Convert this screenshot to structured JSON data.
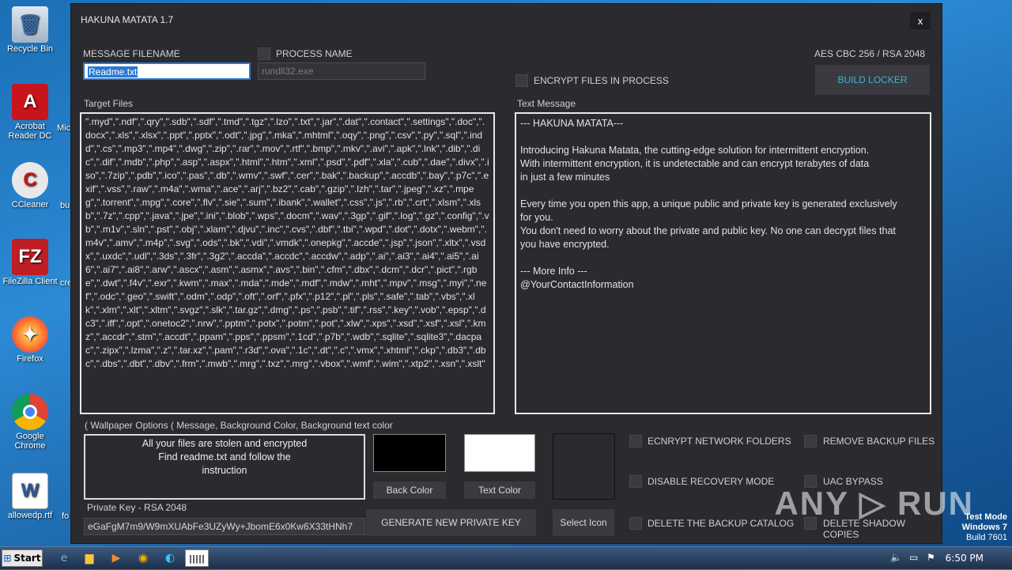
{
  "desktop": {
    "icons": [
      {
        "label": "Recycle Bin"
      },
      {
        "label": "Acrobat Reader DC"
      },
      {
        "label": "CCleaner"
      },
      {
        "label": "FileZilla Client"
      },
      {
        "label": "Firefox"
      },
      {
        "label": "Google Chrome"
      },
      {
        "label": "allowedp.rtf"
      }
    ],
    "edge_labels": [
      "Mic",
      "bu",
      "cre",
      "fo"
    ]
  },
  "window": {
    "title": "HAKUNA MATATA 1.7",
    "close": "x",
    "message_filename_label": "MESSAGE FILENAME",
    "message_filename_value": "Readme.txt",
    "process_name_label": "PROCESS NAME",
    "process_name_value": "rundll32.exe",
    "crypto_label": "AES CBC 256 / RSA 2048",
    "encrypt_in_process_label": "ENCRYPT FILES IN PROCESS",
    "build_button": "BUILD LOCKER",
    "target_files_label": "Target Files",
    "target_files_text": "\".myd\",\".ndf\",\".qry\",\".sdb\",\".sdf\",\".tmd\",\".tgz\",\".lzo\",\".txt\",\".jar\",\".dat\",\".contact\",\".settings\",\".doc\",\".docx\",\".xls\",\".xlsx\",\".ppt\",\".pptx\",\".odt\",\".jpg\",\".mka\",\".mhtml\",\".oqy\",\".png\",\".csv\",\".py\",\".sql\",\".indd\",\".cs\",\".mp3\",\".mp4\",\".dwg\",\".zip\",\".rar\",\".mov\",\".rtf\",\".bmp\",\".mkv\",\".avi\",\".apk\",\".lnk\",\".dib\",\".dic\",\".dif\",\".mdb\",\".php\",\".asp\",\".aspx\",\".html\",\".htm\",\".xml\",\".psd\",\".pdf\",\".xla\",\".cub\",\".dae\",\".divx\",\".iso\",\".7zip\",\".pdb\",\".ico\",\".pas\",\".db\",\".wmv\",\".swf\",\".cer\",\".bak\",\".backup\",\".accdb\",\".bay\",\".p7c\",\".exif\",\".vss\",\".raw\",\".m4a\",\".wma\",\".ace\",\".arj\",\".bz2\",\".cab\",\".gzip\",\".lzh\",\".tar\",\".jpeg\",\".xz\",\".mpeg\",\".torrent\",\".mpg\",\".core\",\".flv\",\".sie\",\".sum\",\".ibank\",\".wallet\",\".css\",\".js\",\".rb\",\".crt\",\".xlsm\",\".xlsb\",\".7z\",\".cpp\",\".java\",\".jpe\",\".ini\",\".blob\",\".wps\",\".docm\",\".wav\",\".3gp\",\".gif\",\".log\",\".gz\",\".config\",\".vb\",\".m1v\",\".sln\",\".pst\",\".obj\",\".xlam\",\".djvu\",\".inc\",\".cvs\",\".dbf\",\".tbi\",\".wpd\",\".dot\",\".dotx\",\".webm\",\".m4v\",\".amv\",\".m4p\",\".svg\",\".ods\",\".bk\",\".vdi\",\".vmdk\",\".onepkg\",\".accde\",\".jsp\",\".json\",\".xltx\",\".vsdx\",\".uxdc\",\".udl\",\".3ds\",\".3fr\",\".3g2\",\".accda\",\".accdc\",\".accdw\",\".adp\",\".ai\",\".ai3\",\".ai4\",\".ai5\",\".ai6\",\".ai7\",\".ai8\",\".arw\",\".ascx\",\".asm\",\".asmx\",\".avs\",\".bin\",\".cfm\",\".dbx\",\".dcm\",\".dcr\",\".pict\",\".rgbe\",\".dwt\",\".f4v\",\".exr\",\".kwm\",\".max\",\".mda\",\".mde\",\".mdf\",\".mdw\",\".mht\",\".mpv\",\".msg\",\".myi\",\".nef\",\".odc\",\".geo\",\".swift\",\".odm\",\".odp\",\".oft\",\".orf\",\".pfx\",\".p12\",\".pl\",\".pls\",\".safe\",\".tab\",\".vbs\",\".xlk\",\".xlm\",\".xlt\",\".xltm\",\".svgz\",\".slk\",\".tar.gz\",\".dmg\",\".ps\",\".psb\",\".tif\",\".rss\",\".key\",\".vob\",\".epsp\",\".dc3\",\".iff\",\".opt\",\".onetoc2\",\".nrw\",\".pptm\",\".potx\",\".potm\",\".pot\",\".xlw\",\".xps\",\".xsd\",\".xsf\",\".xsl\",\".kmz\",\".accdr\",\".stm\",\".accdt\",\".ppam\",\".pps\",\".ppsm\",\".1cd\",\".p7b\",\".wdb\",\".sqlite\",\".sqlite3\",\".dacpac\",\".zipx\",\".lzma\",\".z\",\".tar.xz\",\".pam\",\".r3d\",\".ova\",\".1c\",\".dt\",\".c\",\".vmx\",\".xhtml\",\".ckp\",\".db3\",\".dbc\",\".dbs\",\".dbt\",\".dbv\",\".frm\",\".mwb\",\".mrg\",\".txz\",\".mrg\",\".vbox\",\".wmf\",\".wim\",\".xtp2\",\".xsn\",\".xslt\"",
    "text_message_label": "Text Message",
    "text_message": "--- HAKUNA MATATA---\n\nIntroducing Hakuna Matata, the cutting-edge solution for intermittent encryption.\nWith intermittent encryption, it is undetectable and can encrypt terabytes of data\nin just a few minutes\n\nEvery time you open this app, a unique public and private key is generated exclusively\nfor you.\nYou don't need to worry about the private and public key. No one can decrypt files that\nyou have encrypted.\n\n--- More Info ---\n@YourContactInformation",
    "wallpaper_label": "( Wallpaper Options ( Message, Background Color, Background text color",
    "wallpaper_message": "All your files are stolen and encrypted\nFind readme.txt and follow the\ninstruction",
    "back_color_button": "Back Color",
    "text_color_button": "Text Color",
    "select_icon_button": "Select Icon",
    "back_color": "#000000",
    "text_color": "#ffffff",
    "private_key_label": "Private Key - RSA 2048",
    "private_key_value": "eGaFgM7m9/W9mXUAbFe3UZyWy+JbomE6x0Kw6X33tHNh7",
    "generate_key_button": "GENERATE NEW PRIVATE KEY",
    "options": [
      {
        "label": "ECNRYPT NETWORK FOLDERS"
      },
      {
        "label": "DISABLE RECOVERY MODE"
      },
      {
        "label": "DELETE THE BACKUP CATALOG"
      },
      {
        "label": "REMOVE BACKUP FILES"
      },
      {
        "label": "UAC BYPASS"
      },
      {
        "label": "DELETE SHADOW COPIES"
      }
    ]
  },
  "watermark": "ANY ▷ RUN",
  "os_watermark": {
    "line1": "Test Mode",
    "line2": "Windows 7",
    "line3": "Build 7601"
  },
  "taskbar": {
    "start": "Start",
    "clock": "6:50 PM",
    "active_app": "|||||"
  }
}
